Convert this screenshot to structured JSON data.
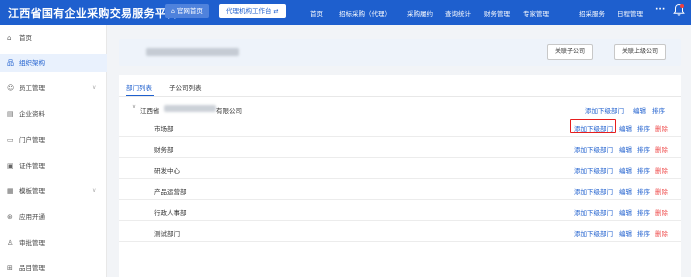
{
  "header": {
    "brand": "江西省国有企业采购交易服务平台",
    "home_label": "官网首页",
    "agent_label": "代理机构工作台",
    "nav": [
      "首页",
      "招标采购（代理）",
      "采购履约",
      "查询统计",
      "财务管理",
      "专家管理",
      "招采服务",
      "日程管理"
    ],
    "more": "···"
  },
  "sidebar": {
    "items": [
      {
        "label": "首页",
        "icon": "home-icon"
      },
      {
        "label": "组织架构",
        "icon": "org-chart-icon"
      },
      {
        "label": "员工管理",
        "icon": "users-icon"
      },
      {
        "label": "企业资料",
        "icon": "building-icon"
      },
      {
        "label": "门户管理",
        "icon": "portal-icon"
      },
      {
        "label": "证件管理",
        "icon": "id-card-icon"
      },
      {
        "label": "模板管理",
        "icon": "template-icon"
      },
      {
        "label": "应用开通",
        "icon": "app-icon"
      },
      {
        "label": "审批管理",
        "icon": "approval-icon"
      },
      {
        "label": "品目管理",
        "icon": "grid-icon"
      }
    ]
  },
  "company_card": {
    "related_subsidiary_btn": "关联子公司",
    "related_parent_btn": "关联上级公司"
  },
  "tabs": [
    {
      "label": "部门列表"
    },
    {
      "label": "子公司列表"
    }
  ],
  "tree": {
    "root": {
      "prefix": "江西省",
      "suffix": "有限公司"
    },
    "root_actions": {
      "add": "添加下级部门",
      "edit": "编辑",
      "sort": "排序"
    },
    "rows": [
      {
        "name": "市场部"
      },
      {
        "name": "财务部"
      },
      {
        "name": "研发中心"
      },
      {
        "name": "产品运营部"
      },
      {
        "name": "行政人事部"
      },
      {
        "name": "测试部门"
      }
    ],
    "row_actions": {
      "add": "添加下级部门",
      "edit": "编辑",
      "sort": "排序",
      "delete": "删除"
    }
  },
  "colors": {
    "primary": "#1e5fce",
    "danger": "#f05050",
    "highlight": "#e61e1e"
  }
}
